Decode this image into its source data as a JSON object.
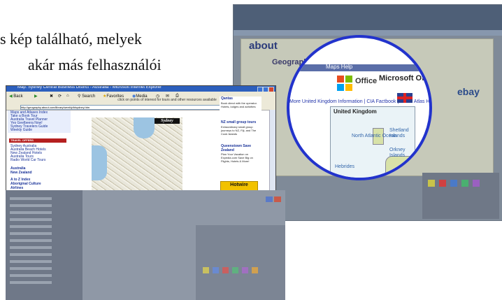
{
  "caption": {
    "line1": "s kép található, melyek",
    "line2": "akár más felhasználói"
  },
  "right_window": {
    "site_logo": "about",
    "site_section": "Geography",
    "ad_logo": "ebay"
  },
  "magnifier": {
    "header_text": "Maps Help",
    "office_brand": "Office",
    "office_small": "Microsoft",
    "office_title": "Microsoft Office System",
    "links_text": "More United Kingdom Information | CIA Factbook | World Atlas Home",
    "map": {
      "title": "United Kingdom",
      "labels": [
        "North Atlantic Ocean",
        "Shetland Islands",
        "Orkney Islands",
        "Hebrides"
      ]
    }
  },
  "browser": {
    "title": "Map: Sydney Central Business District - Australia - Microsoft Internet Explorer",
    "toolbar": {
      "back": "Back",
      "search": "Search",
      "favorites": "Favorites",
      "media": "Media"
    },
    "address": "http://geography.about.com/library/weekly/blsydney.htm",
    "nav_top": [
      "Maps and Atlases Index",
      "Take a Book Tour",
      "Australia Travel Planner",
      "Yes Geelbeera Now!",
      "Sydney Travelers Guide",
      "Weekly Guide"
    ],
    "travel_header": "TRAVEL OFFERS",
    "travel_links": [
      "Sydney Australia",
      "Australia Beach Hotels",
      "New Zealand Hotels",
      "Australia Tours",
      "Radio World Car Tours"
    ],
    "big_links": [
      "Australia",
      "New Zealand",
      "A to Z Index",
      "Aboriginal Culture",
      "Airlines"
    ],
    "map_caption": "click on points of interest for tours and other resources available",
    "map_label": "Sydney",
    "ads": [
      {
        "title": "Qantas",
        "text": "Book direct with the operator. Hotels, lodges and activities"
      },
      {
        "title": "NZ small group tours",
        "text": "Extraordinary small group journeys to NZ, Fiji, and The Cook Islands"
      },
      {
        "title": "Queenstown Save Zealand",
        "text": "Plan Your Vacation on Expedia.com Save Big on Flights, Hotels & More!"
      }
    ],
    "hotwire": "Hotwire"
  },
  "colors": {
    "magnifier_ring": "#2233cc",
    "browser_titlebar": "#2c5fbd",
    "nav_link": "#1a3399",
    "travel_header": "#b52020"
  }
}
